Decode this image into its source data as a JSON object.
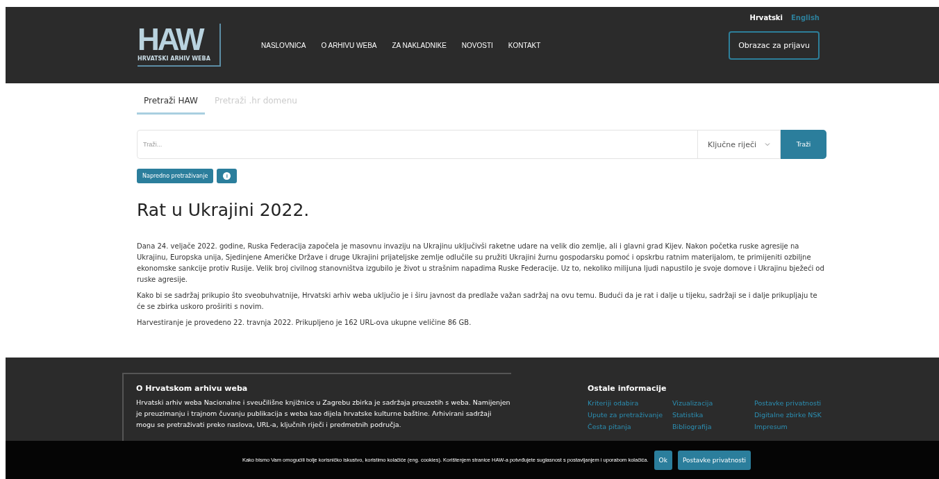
{
  "languages": [
    {
      "label": "Hrvatski",
      "selected": true
    },
    {
      "label": "English",
      "selected": false
    }
  ],
  "logo": {
    "letters": "HAW",
    "subtitle": "HRVATSKI ARHIV WEBA"
  },
  "nav": [
    "NASLOVNICA",
    "O ARHIVU WEBA",
    "ZA NAKLADNIKE",
    "NOVOSTI",
    "KONTAKT"
  ],
  "signup_button": "Obrazac za prijavu",
  "search_tabs": [
    {
      "label": "Pretraži HAW",
      "selected": true
    },
    {
      "label": "Pretraži .hr domenu",
      "selected": false
    }
  ],
  "search": {
    "placeholder": "Traži...",
    "mode": "Ključne riječi",
    "button": "Traži"
  },
  "advanced_button": "Napredno pretraživanje",
  "info_button": "i",
  "heading": "Rat u Ukrajini 2022.",
  "paragraphs": [
    "Dana 24. veljače 2022. godine, Ruska Federacija započela je masovnu invaziju na Ukrajinu uključivši raketne udare na velik dio zemlje, ali i glavni grad Kijev. Nakon početka ruske agresije na Ukrajinu, Europska unija, Sjedinjene Američke Države i druge Ukrajini prijateljske zemlje odlučile su pružiti Ukrajini žurnu gospodarsku pomoć i opskrbu ratnim materijalom, te primijeniti ozbiljne ekonomske sankcije protiv Rusije. Velik broj civilnog stanovništva izgubilo je život u strašnim napadima Ruske Federacije. Uz to, nekoliko milijuna ljudi napustilo je svoje domove i Ukrajinu bježeći od ruske agresije.",
    "Kako bi se sadržaj prikupio što sveobuhvatnije, Hrvatski arhiv weba uključio je i širu javnost da predlaže važan sadržaj na ovu temu. Budući da je rat i dalje u tijeku, sadržaji se i dalje prikupljaju te će se zbirka uskoro proširiti s novim.",
    "Harvestiranje je provedeno 22. travnja 2022. Prikupljeno je 162 URL-ova ukupne veličine 86 GB."
  ],
  "footer": {
    "about_title": "O Hrvatskom arhivu weba",
    "about_text": "Hrvatski arhiv weba Nacionalne i sveučilišne knjižnice u Zagrebu zbirka je sadržaja preuzetih s weba. Namijenjen je preuzimanju i trajnom čuvanju publikacija s weba kao dijela hrvatske kulturne baštine. Arhivirani sadržaji mogu se pretraživati preko naslova, URL-a, ključnih riječi i predmetnih područja.",
    "info_title": "Ostale informacije",
    "link_columns": [
      [
        "Kriteriji odabira",
        "Upute za pretraživanje",
        "Česta pitanja"
      ],
      [
        "Vizualizacija",
        "Statistika",
        "Bibliografija"
      ],
      [
        "Postavke privatnosti",
        "Digitalne zbirke NSK",
        "Impresum"
      ]
    ]
  },
  "cookie_bar": {
    "text": "Kako bismo Vam omogućili bolje korisničko iskustvo, koristimo kolačiće (eng. cookies). Korištenjem stranice HAW-a potvrđujete suglasnost s postavljanjem i uporabom kolačića.",
    "buttons": [
      "Ok",
      "Postavke privatnosti"
    ]
  }
}
